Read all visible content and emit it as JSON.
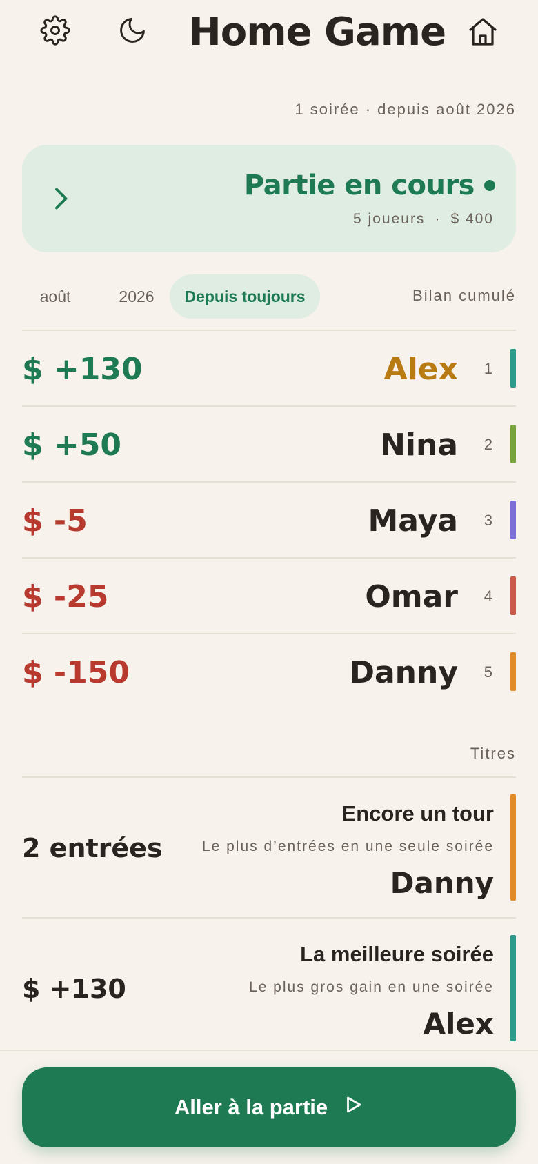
{
  "header": {
    "title": "Home Game",
    "icons": [
      "gear-icon",
      "moon-icon",
      "home-icon"
    ]
  },
  "summary": {
    "subtitle": "1 soirée · depuis août 2026"
  },
  "live_game": {
    "title": "Partie en cours",
    "players": "5 joueurs",
    "separator": "·",
    "pot": "$ 400",
    "accent": "#1d7a52"
  },
  "filters": {
    "chips": [
      {
        "label": "août"
      },
      {
        "label": "2026"
      },
      {
        "label": "Depuis toujours"
      }
    ],
    "active": "Depuis toujours",
    "label": "Bilan cumulé"
  },
  "standings": [
    {
      "amount": "$ +130",
      "name": "Alex",
      "rank": "1",
      "color": "#2e9a8c"
    },
    {
      "amount": "$ +50",
      "name": "Nina",
      "rank": "2",
      "color": "#76a33e"
    },
    {
      "amount": "$ -5",
      "name": "Maya",
      "rank": "3",
      "color": "#7b6fd6"
    },
    {
      "amount": "$ -25",
      "name": "Omar",
      "rank": "4",
      "color": "#c95a4a"
    },
    {
      "amount": "$ -150",
      "name": "Danny",
      "rank": "5",
      "color": "#e08b2a"
    }
  ],
  "titles": {
    "label": "Titres",
    "items": [
      {
        "stat": "2 entrées",
        "name": "Encore un tour",
        "description": "Le plus d’entrées en une seule soirée",
        "winner": "Danny",
        "color": "#e08b2a"
      },
      {
        "stat": "$ +130",
        "name": "La meilleure soirée",
        "description": "Le plus gros gain en une soirée",
        "winner": "Alex",
        "color": "#2e9a8c"
      }
    ]
  },
  "cta": {
    "label": "Aller à la partie"
  },
  "colors": {
    "background": "#f7f2ec",
    "positive": "#1d7a52",
    "negative": "#b83a2e",
    "leader": "#b87a12"
  }
}
